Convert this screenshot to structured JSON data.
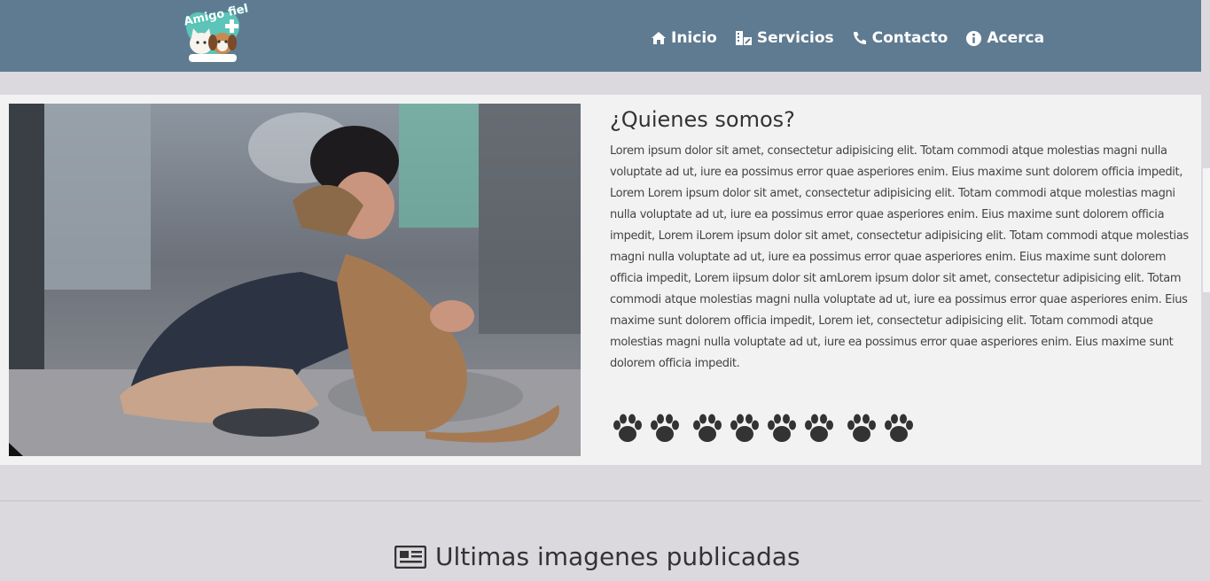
{
  "navbar": {
    "logo_text": "Amigo fiel",
    "items": [
      {
        "label": "Inicio",
        "icon": "home-icon"
      },
      {
        "label": "Servicios",
        "icon": "services-icon"
      },
      {
        "label": "Contacto",
        "icon": "phone-icon"
      },
      {
        "label": "Acerca",
        "icon": "info-icon"
      }
    ]
  },
  "about": {
    "title": "¿Quienes somos?",
    "text": "Lorem ipsum dolor sit amet, consectetur adipisicing elit. Totam commodi atque molestias magni nulla voluptate ad ut, iure ea possimus error quae asperiores enim. Eius maxime sunt dolorem officia impedit, Lorem Lorem ipsum dolor sit amet, consectetur adipisicing elit. Totam commodi atque molestias magni nulla voluptate ad ut, iure ea possimus error quae asperiores enim. Eius maxime sunt dolorem officia impedit, Lorem iLorem ipsum dolor sit amet, consectetur adipisicing elit. Totam commodi atque molestias magni nulla voluptate ad ut, iure ea possimus error quae asperiores enim. Eius maxime sunt dolorem officia impedit, Lorem iipsum dolor sit amLorem ipsum dolor sit amet, consectetur adipisicing elit. Totam commodi atque molestias magni nulla voluptate ad ut, iure ea possimus error quae asperiores enim. Eius maxime sunt dolorem officia impedit, Lorem iet, consectetur adipisicing elit. Totam commodi atque molestias magni nulla voluptate ad ut, iure ea possimus error quae asperiores enim. Eius maxime sunt dolorem officia impedit.",
    "paw_count": 8
  },
  "latest": {
    "heading": "Ultimas imagenes publicadas",
    "icon": "newspaper-icon"
  },
  "colors": {
    "navbar": "#5f7b91",
    "background": "#dcd9de",
    "panel": "#f2f2f2",
    "text": "#444444"
  }
}
